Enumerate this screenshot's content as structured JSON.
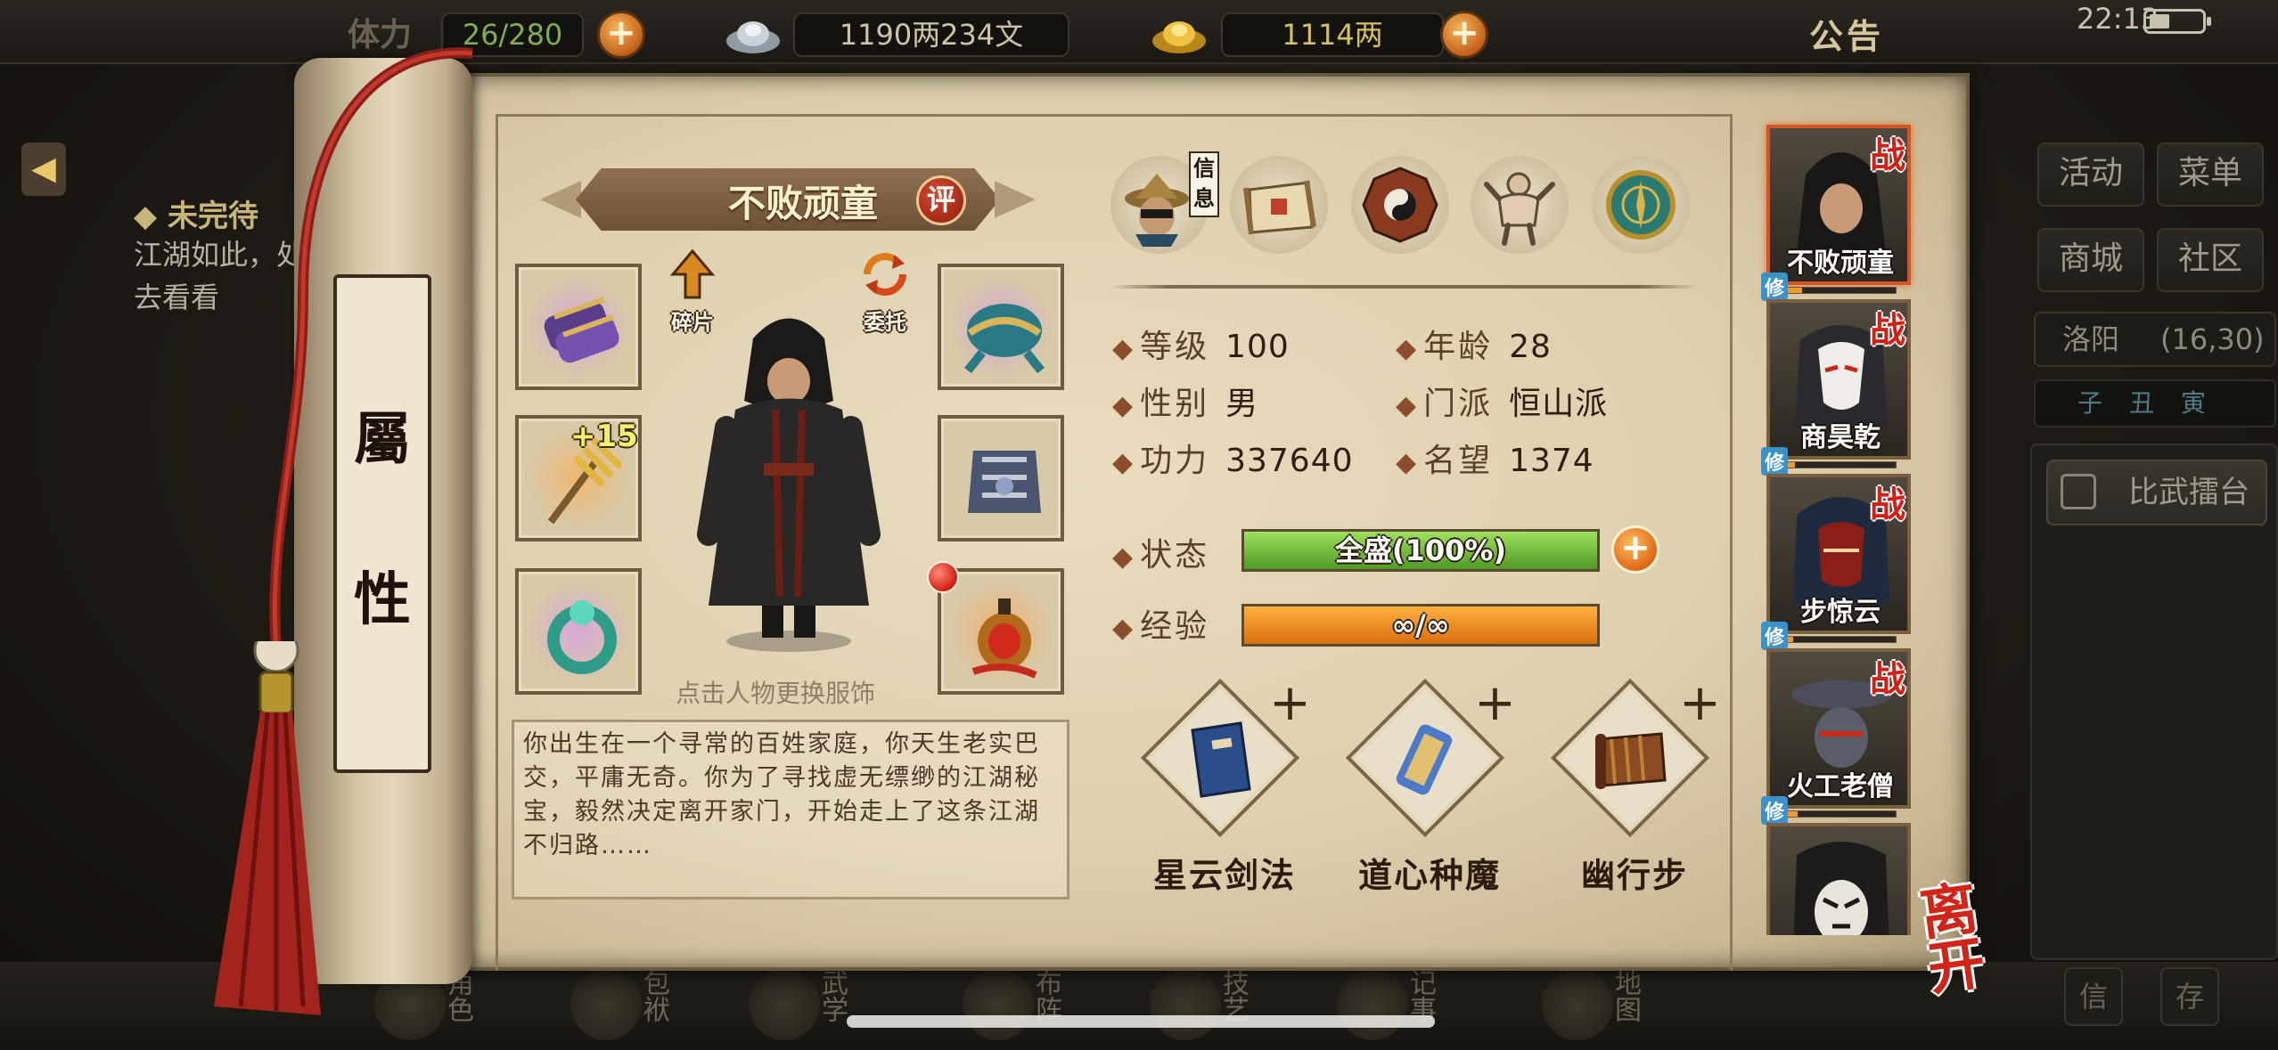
{
  "topbar": {
    "stamina_label": "体力",
    "stamina_value": "26/280",
    "silver": "1190两234文",
    "gold": "1114两",
    "notice": "公告",
    "clock": "22:13"
  },
  "quest": {
    "title": "◆ 未完待",
    "text": "江湖如此，处去看看"
  },
  "side_menu": {
    "activity": "活动",
    "menu": "菜单",
    "shop": "商城",
    "community": "社区"
  },
  "location": {
    "city": "洛阳",
    "coords": "(16,30)",
    "time_marks": "子丑寅"
  },
  "arena": "比武擂台",
  "scroll_tab": {
    "char1": "屬",
    "char2": "性"
  },
  "hero": {
    "name": "不败顽童",
    "eval": "评",
    "fragment": "碎片",
    "entrust": "委托",
    "enhance": "+15",
    "change_hint": "点击人物更换服饰",
    "bio": "你出生在一个寻常的百姓家庭，你天生老实巴交，平庸无奇。你为了寻找虚无缥缈的江湖秘宝，毅然决定离开家门，开始走上了这条江湖不归路……"
  },
  "info_tag": "信息",
  "info_icons": [
    "portrait-icon",
    "scroll-map-icon",
    "bagua-icon",
    "muscle-icon",
    "compass-icon"
  ],
  "stats": {
    "level_label": "等级",
    "level": "100",
    "age_label": "年龄",
    "age": "28",
    "gender_label": "性别",
    "gender": "男",
    "sect_label": "门派",
    "sect": "恒山派",
    "power_label": "功力",
    "power": "337640",
    "fame_label": "名望",
    "fame": "1374",
    "state_label": "状态",
    "state": "全盛(100%)",
    "state_fill": 1.0,
    "exp_label": "经验",
    "exp": "∞/∞",
    "exp_fill": 1.0
  },
  "skills": [
    {
      "name": "星云剑法",
      "plus": "+"
    },
    {
      "name": "道心种魔",
      "plus": "+"
    },
    {
      "name": "幽行步",
      "plus": "+"
    }
  ],
  "roster": [
    {
      "name": "不败顽童",
      "tag": "战",
      "xiu": "修"
    },
    {
      "name": "商昊乾",
      "tag": "战",
      "xiu": "修"
    },
    {
      "name": "步惊云",
      "tag": "战",
      "xiu": "修"
    },
    {
      "name": "火工老僧",
      "tag": "战",
      "xiu": "修"
    }
  ],
  "leave": "离开",
  "bottom_nav": [
    "角色",
    "包袱",
    "武学",
    "布阵",
    "技艺",
    "记事",
    "地图"
  ],
  "bottom_right": [
    "信",
    "存"
  ],
  "colors": {
    "state_bar": "#6fb83a",
    "exp_bar": "#e8861a",
    "active_border": "#d35426"
  }
}
